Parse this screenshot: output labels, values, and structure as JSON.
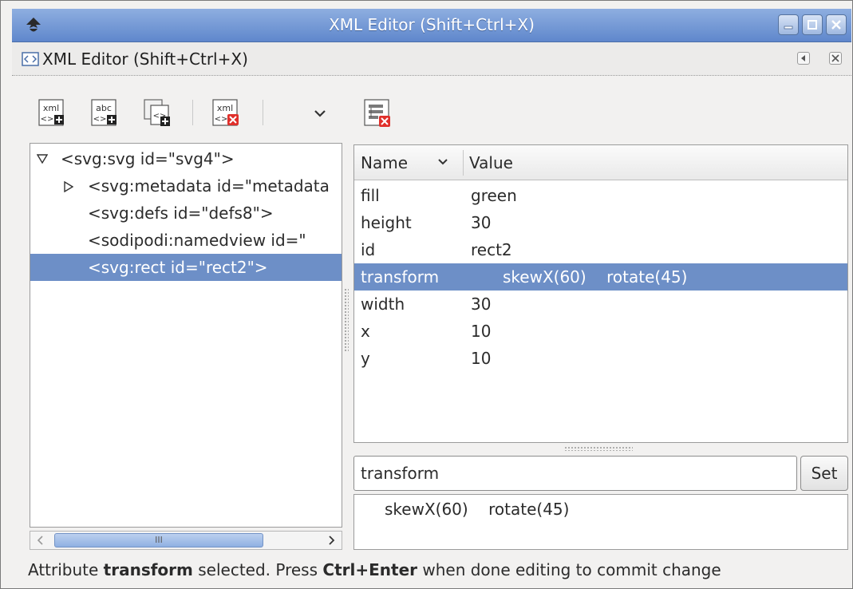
{
  "window": {
    "title": "XML Editor (Shift+Ctrl+X)"
  },
  "dock": {
    "title": "XML Editor (Shift+Ctrl+X)"
  },
  "node_toolbar": {
    "buttons": [
      {
        "icon": "new-element-node-icon",
        "glyph": "xml"
      },
      {
        "icon": "new-text-node-icon",
        "glyph": "abc"
      },
      {
        "icon": "duplicate-node-icon",
        "glyph": ""
      },
      {
        "icon": "delete-node-icon",
        "glyph": "xml"
      },
      {
        "icon": "chevron-down-icon",
        "glyph": "⌄"
      }
    ]
  },
  "attr_toolbar": {
    "buttons": [
      {
        "icon": "delete-attribute-icon"
      }
    ]
  },
  "tree": {
    "nodes": [
      {
        "label": "<svg:svg id=\"svg4\">",
        "expander": "expanded",
        "level": 0,
        "selected": false
      },
      {
        "label": "<svg:metadata id=\"metadata",
        "expander": "collapsed",
        "level": 1,
        "selected": false
      },
      {
        "label": "<svg:defs id=\"defs8\">",
        "expander": "none",
        "level": 1,
        "selected": false
      },
      {
        "label": "<sodipodi:namedview id=\"",
        "expander": "none",
        "level": 1,
        "selected": false
      },
      {
        "label": "<svg:rect id=\"rect2\">",
        "expander": "none",
        "level": 1,
        "selected": true
      }
    ],
    "scrollbar": {
      "thumb_grip": "III"
    }
  },
  "attributes": {
    "headers": {
      "name": "Name",
      "value": "Value"
    },
    "rows": [
      {
        "name": "fill",
        "value": "green",
        "selected": false
      },
      {
        "name": "height",
        "value": "30",
        "selected": false
      },
      {
        "name": "id",
        "value": "rect2",
        "selected": false
      },
      {
        "name": "transform",
        "value": "skewX(60)    rotate(45)",
        "selected": true
      },
      {
        "name": "width",
        "value": "30",
        "selected": false
      },
      {
        "name": "x",
        "value": "10",
        "selected": false
      },
      {
        "name": "y",
        "value": "10",
        "selected": false
      }
    ]
  },
  "editor": {
    "attribute_name": "transform",
    "set_label": "Set",
    "attribute_value": "skewX(60)    rotate(45)"
  },
  "status": {
    "part1": "Attribute ",
    "bold1": "transform",
    "part2": " selected. Press ",
    "bold2": "Ctrl+Enter",
    "part3": " when done editing to commit change"
  },
  "colors": {
    "selection": "#6d8fc7",
    "titlebar": "#5f87cc",
    "delete_red": "#e0302b"
  }
}
